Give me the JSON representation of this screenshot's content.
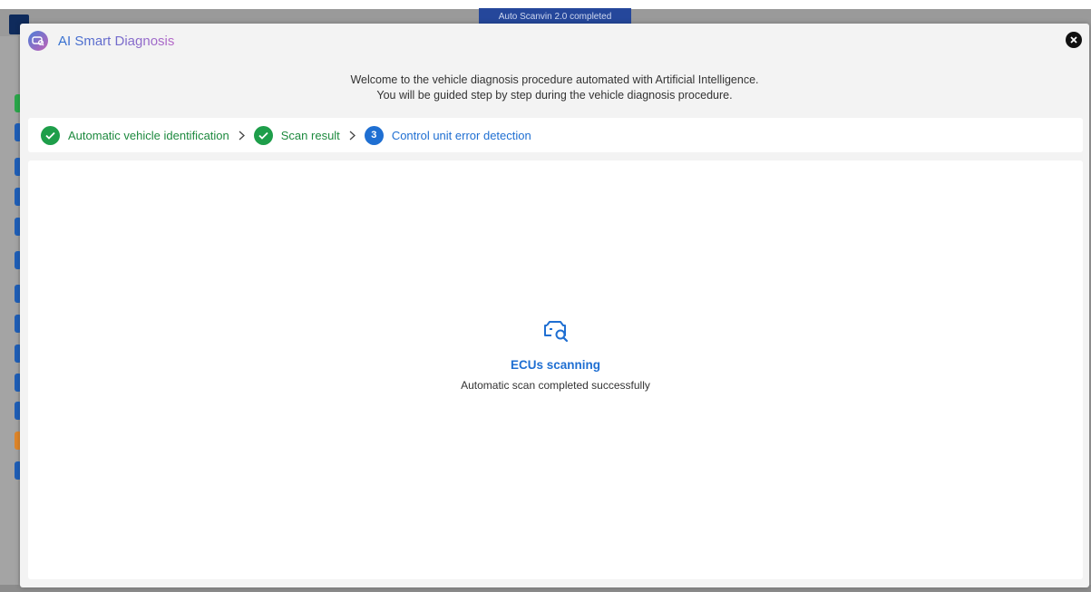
{
  "background": {
    "toast_text": "Auto Scanvin 2.0 completed",
    "marker_colors": [
      "#2aa84a",
      "#1f5fb8",
      "#1f5fb8",
      "#1f5fb8",
      "#1f5fb8",
      "#1f5fb8",
      "#1f5fb8",
      "#1f5fb8",
      "#1f5fb8",
      "#1f5fb8",
      "#1f5fb8",
      "#e0862a",
      "#1f5fb8"
    ]
  },
  "modal": {
    "title": "AI Smart Diagnosis",
    "close_icon": "close-icon",
    "welcome_line1": "Welcome to the vehicle diagnosis procedure automated with Artificial Intelligence.",
    "welcome_line2": "You will be guided step by step during the vehicle diagnosis procedure."
  },
  "stepper": {
    "steps": [
      {
        "label": "Automatic vehicle identification",
        "state": "done",
        "icon": "check-icon"
      },
      {
        "label": "Scan result",
        "state": "done",
        "icon": "check-icon"
      },
      {
        "label": "Control unit error detection",
        "state": "active",
        "number": "3"
      }
    ]
  },
  "status": {
    "icon": "car-scan-icon",
    "title": "ECUs scanning",
    "message": "Automatic scan completed successfully"
  },
  "colors": {
    "accent": "#1f6fd2",
    "success": "#1e9e4a"
  }
}
